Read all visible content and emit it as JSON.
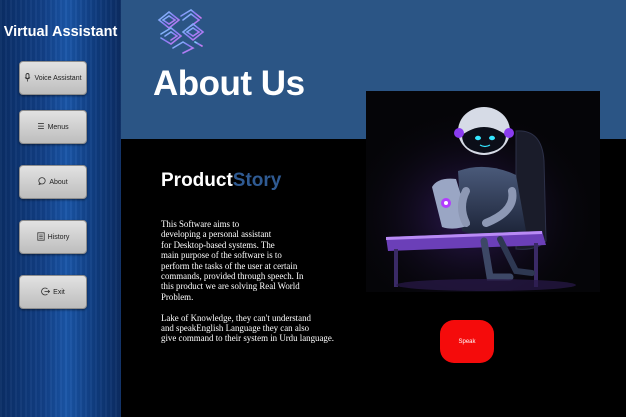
{
  "sidebar": {
    "title": "Virtual Assistant",
    "items": [
      {
        "label": "Voice Assistant",
        "icon": "microphone-icon"
      },
      {
        "label": "Menus",
        "icon": "menu-icon"
      },
      {
        "label": "About",
        "icon": "chat-icon"
      },
      {
        "label": "History",
        "icon": "history-icon"
      },
      {
        "label": "Exit",
        "icon": "exit-icon"
      }
    ]
  },
  "header": {
    "title": "About Us",
    "logo_icon": "brain-circuit-icon"
  },
  "product": {
    "heading_word1": "Product",
    "heading_word2": "Story",
    "lines": [
      "This Software aims to",
      "developing a personal assistant",
      "for Desktop-based systems. The",
      "main purpose of the software is to",
      "perform the tasks of the user at certain",
      "commands, provided through speech. In",
      "this product we are solving Real World",
      "Problem."
    ],
    "lines2": [
      "Lake of Knowledge, they can't understand",
      "and speakEnglish Language they can also",
      "give command to their system in Urdu language."
    ]
  },
  "speak_button": {
    "label": "Speak"
  },
  "colors": {
    "header_bg": "#2b5585",
    "accent_red": "#f50b0b",
    "story_blue": "#2f5a92"
  }
}
